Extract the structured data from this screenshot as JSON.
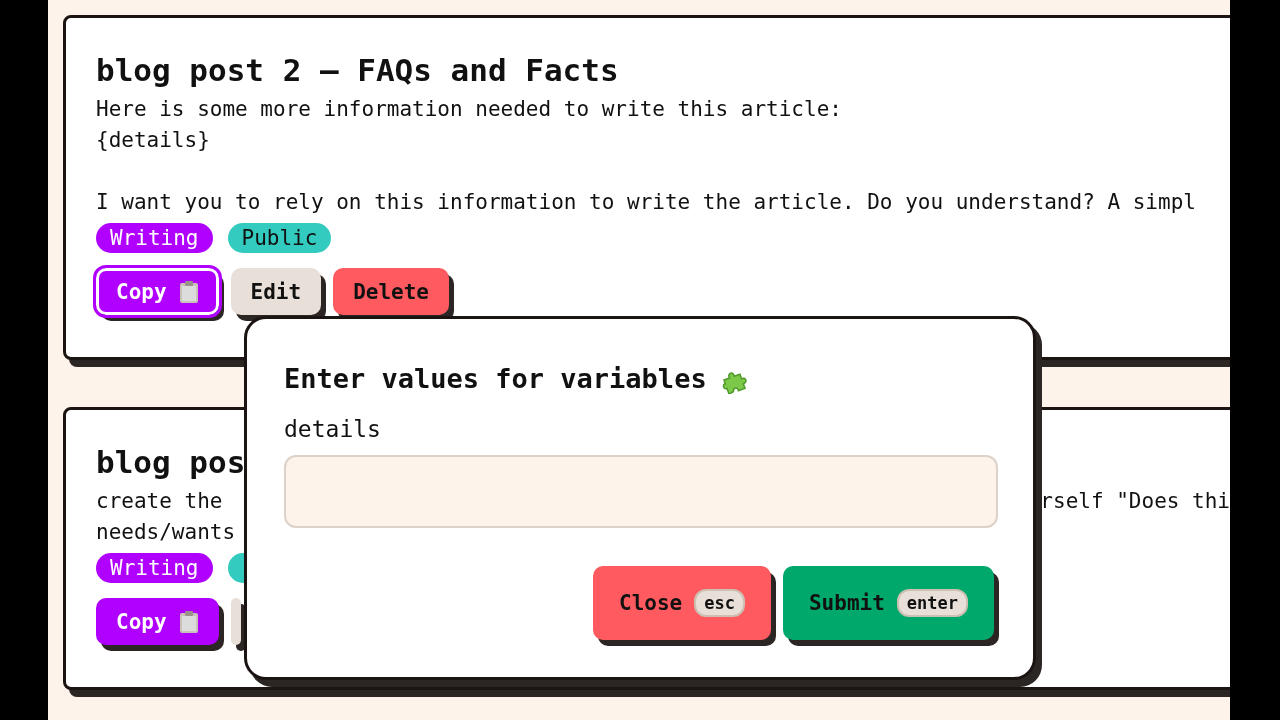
{
  "cards": [
    {
      "title": "blog post 2 – FAQs and Facts",
      "paragraphs": [
        [
          {
            "text": "Here is some more information needed to write this article:"
          },
          {
            "text": "{details}"
          }
        ],
        [
          {
            "text": "I want you to rely on this information to write the article. Do you understand? A simpl"
          }
        ]
      ],
      "tags": [
        {
          "label": "Writing",
          "color": "#b000ff"
        },
        {
          "label": "Public",
          "color": "#33cbbf"
        }
      ],
      "buttons": [
        {
          "kind": "copy",
          "label": "Copy",
          "focused": true
        },
        {
          "kind": "edit",
          "label": "Edit"
        },
        {
          "kind": "delete",
          "label": "Delete"
        }
      ]
    },
    {
      "title": "blog pos",
      "paragraphs": [
        [
          {
            "text": "create the",
            "right": "rself \"Does thi"
          },
          {
            "text": "needs/wants"
          }
        ]
      ],
      "tags": [
        {
          "label": "Writing",
          "color": "#b000ff"
        },
        {
          "color": "#33cbbf"
        }
      ],
      "buttons": [
        {
          "kind": "copy",
          "label": "Copy",
          "focused": false
        },
        {
          "kind": "edit"
        }
      ]
    }
  ],
  "modal": {
    "title": "Enter values for variables",
    "field_label": "details",
    "buttons": [
      {
        "kind": "close",
        "label": "Close",
        "shortcut": "esc"
      },
      {
        "kind": "submit",
        "label": "Submit",
        "shortcut": "enter"
      }
    ]
  }
}
